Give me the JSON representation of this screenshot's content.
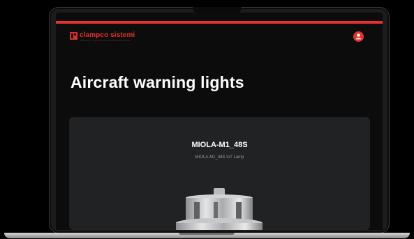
{
  "brand": {
    "name": "clampco sistemi",
    "tagline": "SISTEMI DI SEGNALAZIONE AEROPORTUALE",
    "accent_color": "#e0352f"
  },
  "header": {
    "avatar_icon": "user-icon"
  },
  "page": {
    "title": "Aircraft warning lights"
  },
  "product": {
    "name": "MIOLA-M1_48S",
    "description": "MIOLA-M1_48S IoT Lamp",
    "image_icon": "warning-lamp-icon"
  },
  "colors": {
    "background": "#0c0c0d",
    "card": "#212224",
    "accent": "#e53030"
  }
}
